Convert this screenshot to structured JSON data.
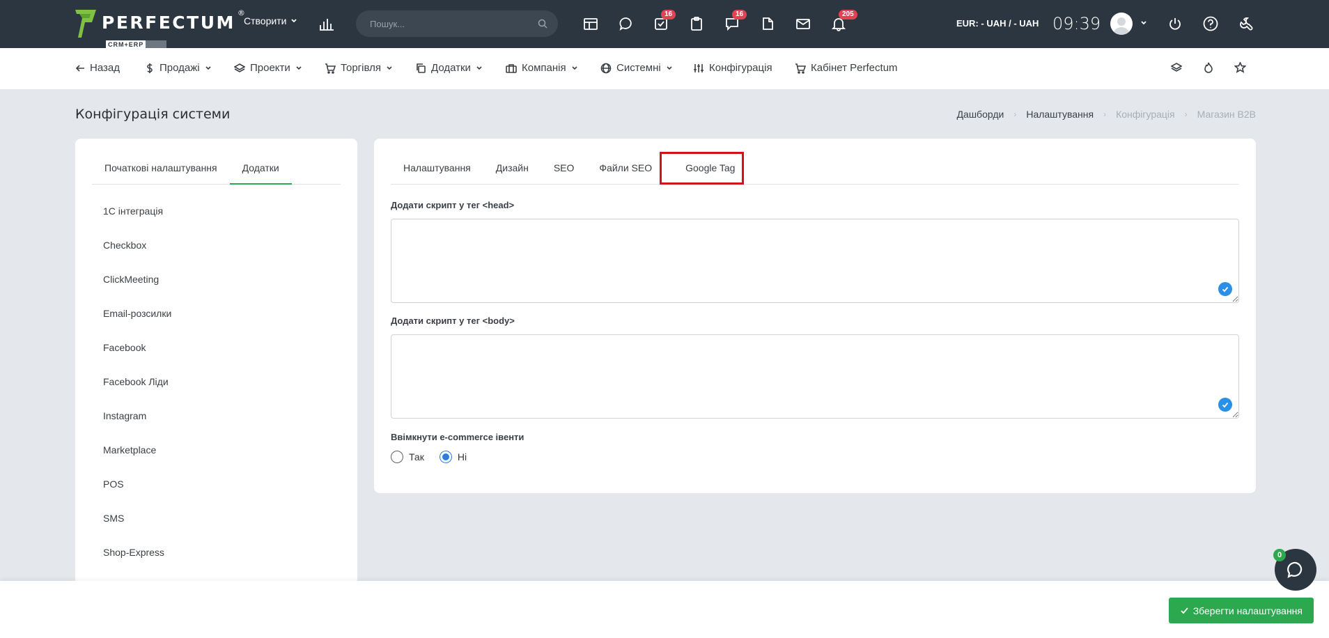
{
  "brand": {
    "name": "PERFECTUM",
    "reg": "®",
    "sub": "CRM+ERP"
  },
  "topbar": {
    "create_label": "Створити",
    "search_placeholder": "Пошук...",
    "badges": {
      "tasks": "16",
      "messages": "16",
      "notifications": "205"
    },
    "currency": "EUR: - UAH / - UAH",
    "time": "09:39"
  },
  "nav": {
    "back": "Назад",
    "sales": "Продажі",
    "projects": "Проекти",
    "trade": "Торгівля",
    "addons": "Додатки",
    "company": "Компанія",
    "system": "Системні",
    "config": "Конфігурація",
    "cabinet": "Кабінет Perfectum"
  },
  "page": {
    "title": "Конфігурація системи",
    "breadcrumb": [
      "Дашборди",
      "Налаштування",
      "Конфігурація",
      "Магазин B2B"
    ]
  },
  "left": {
    "tabs": [
      "Початкові налаштування",
      "Додатки"
    ],
    "items": [
      "1С інтеграція",
      "Checkbox",
      "ClickMeeting",
      "Email-розсилки",
      "Facebook",
      "Facebook Ліди",
      "Instagram",
      "Marketplace",
      "POS",
      "SMS",
      "Shop-Express"
    ]
  },
  "right": {
    "tabs": [
      "Налаштування",
      "Дизайн",
      "SEO",
      "Файли SEO",
      "Google Tag"
    ],
    "head_label": "Додати скрипт у тег <head>",
    "head_value": "",
    "body_label": "Додати скрипт у тег <body>",
    "body_value": "",
    "ecommerce_label": "Ввімкнути e-commerce івенти",
    "radio_yes": "Так",
    "radio_no": "Ні",
    "selected": "Ні"
  },
  "footer": {
    "save_label": "Зберегти налаштування"
  },
  "chat": {
    "count": "0"
  },
  "colors": {
    "topbar": "#2c3641",
    "accent_green": "#2ca94f",
    "highlight_red": "#d2121a",
    "badge_red": "#e04453",
    "check_blue": "#2a8fe7"
  }
}
